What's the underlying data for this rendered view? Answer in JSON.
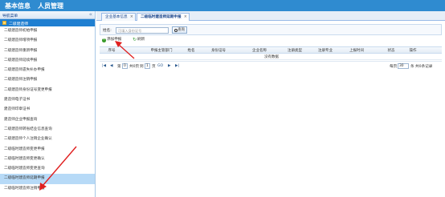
{
  "header": {
    "app_title": "基本信息",
    "nav_item": "人员管理"
  },
  "sidebar": {
    "title": "导航菜单",
    "collapse_glyph": "«",
    "group_label": "二级建造师",
    "items": [
      {
        "label": "二级建造师初始申报"
      },
      {
        "label": "二级建造师增项申报"
      },
      {
        "label": "二级建造师重新申报"
      },
      {
        "label": "二级建造师延续申报"
      },
      {
        "label": "二级建造师遗失补办申报"
      },
      {
        "label": "二级建造师注销申报"
      },
      {
        "label": "二级建造师身份证号变更申报"
      },
      {
        "label": "建造师电子证书"
      },
      {
        "label": "建造师印章证书"
      },
      {
        "label": "建造师企业申报查询"
      },
      {
        "label": "二级建造师转省结业信息查询"
      },
      {
        "label": "二级建造师个人注销企业确认"
      },
      {
        "label": "二级临时建造师变更申报"
      },
      {
        "label": "二级临时建造师变更确认"
      },
      {
        "label": "二级临时建造师变更查询"
      },
      {
        "label": "二级临时建造师延期申报",
        "active": true
      },
      {
        "label": "二级临时建造师注销申报"
      }
    ]
  },
  "tabs": [
    {
      "label": "企业基本信息",
      "close": "×"
    },
    {
      "label": "二级临时建造师延期申报",
      "close": "×",
      "active": true
    }
  ],
  "search": {
    "label": "姓名:",
    "placeholder": "可填入身份证号",
    "button_label": "查询"
  },
  "toolbar": {
    "add_label": "添加申报",
    "refresh_label": "刷新"
  },
  "table": {
    "columns": [
      "序号",
      "申报主管部门",
      "姓名",
      "身份证号",
      "企业名称",
      "注册类型",
      "注册专业",
      "上报时间",
      "状态",
      "操作"
    ],
    "empty_text": "没有数据"
  },
  "pager": {
    "first": "|◀",
    "prev": "◀",
    "page_prefix": "第",
    "page_value": "0",
    "page_suffix": "共0页",
    "goto_prefix": "到",
    "goto_value": "1",
    "goto_suffix": "页",
    "go_label": "GO",
    "next": "▶",
    "last": "▶|",
    "per_page_prefix": "每页",
    "per_page_value": "30",
    "per_page_suffix": "条 共0条记录"
  },
  "colors": {
    "header_bg": "#2f8bd0",
    "group_bg": "#1f7fd1",
    "active_item_bg": "#b7daf7",
    "annotation_arrow": "#e02020"
  }
}
